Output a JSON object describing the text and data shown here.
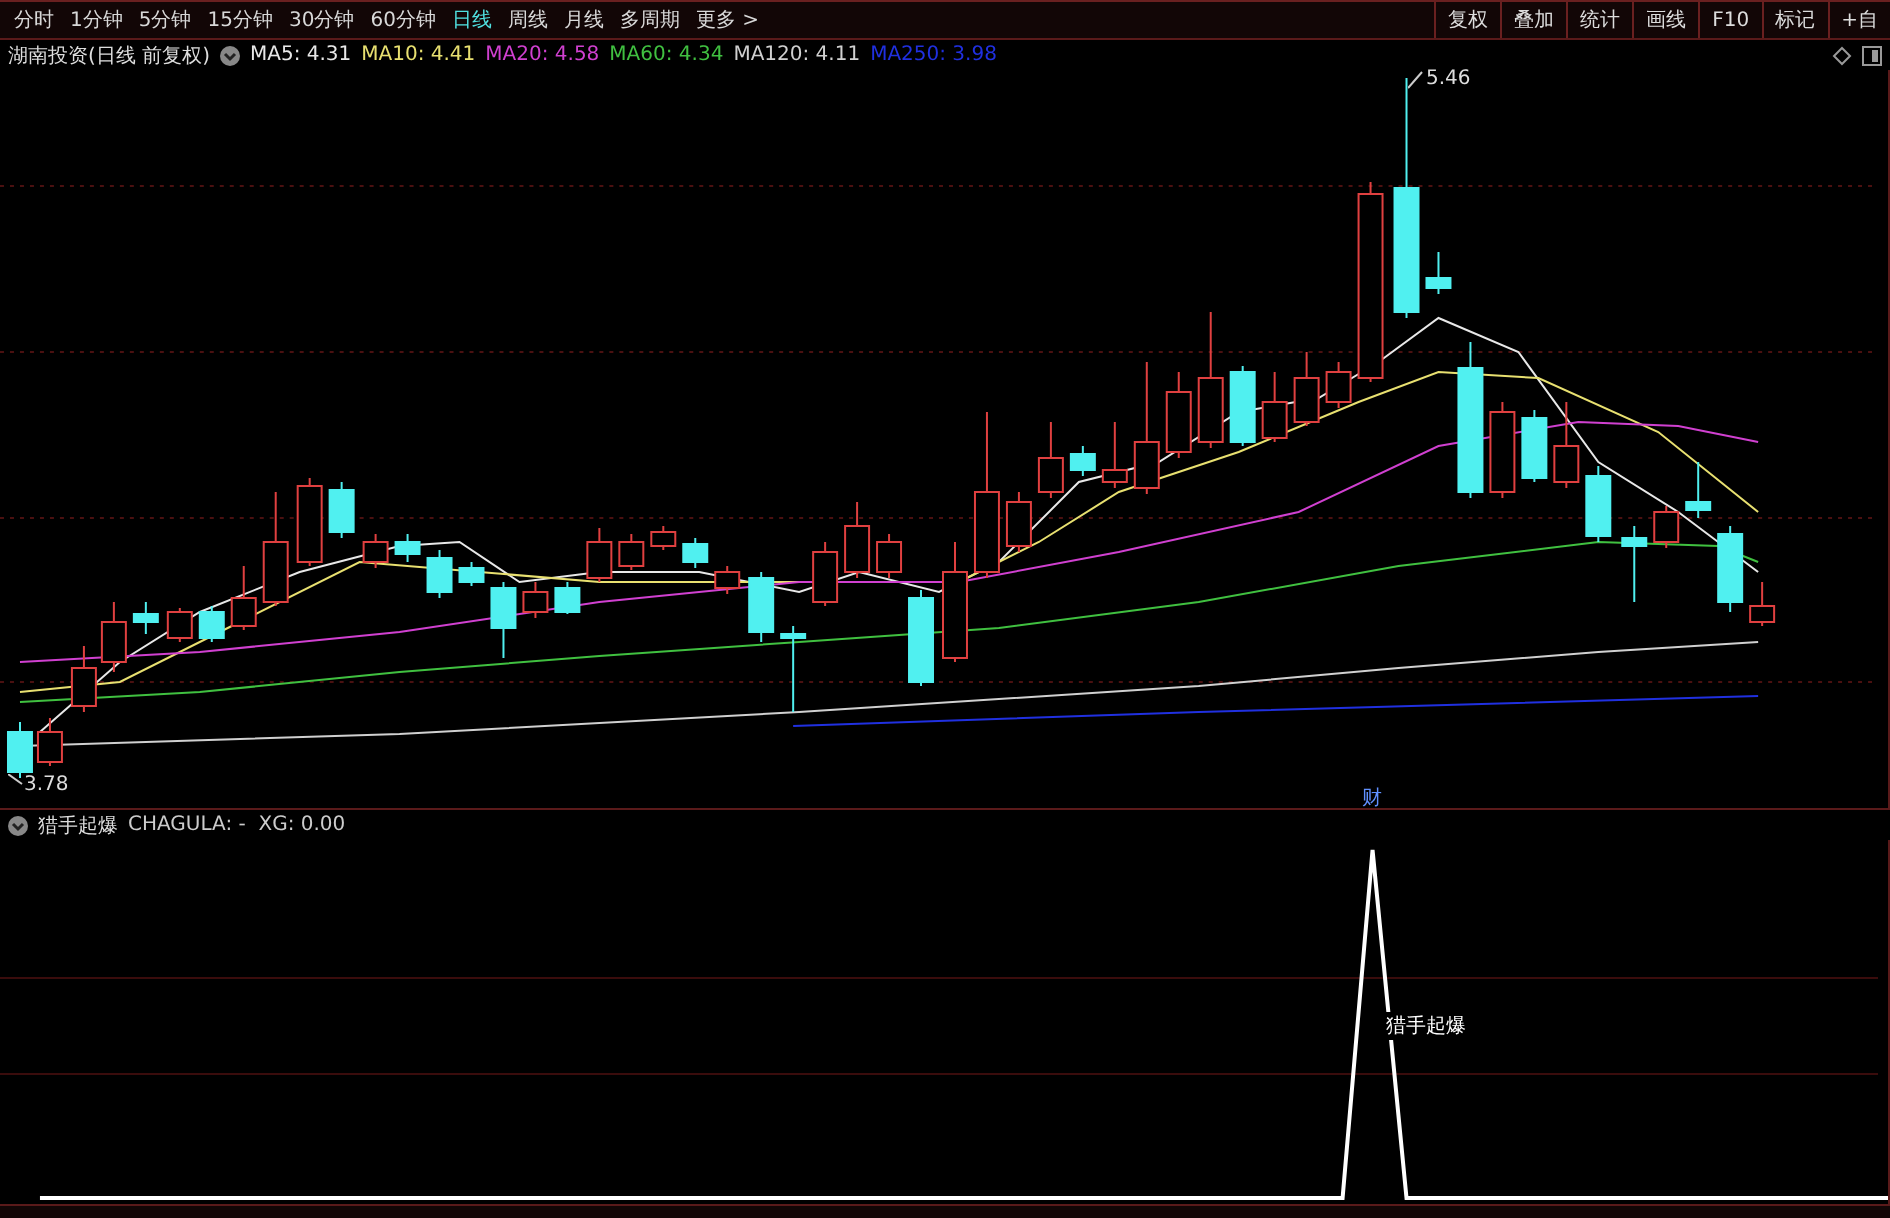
{
  "period_tabs": [
    {
      "label": "分时",
      "selected": false
    },
    {
      "label": "1分钟",
      "selected": false
    },
    {
      "label": "5分钟",
      "selected": false
    },
    {
      "label": "15分钟",
      "selected": false
    },
    {
      "label": "30分钟",
      "selected": false
    },
    {
      "label": "60分钟",
      "selected": false
    },
    {
      "label": "日线",
      "selected": true
    },
    {
      "label": "周线",
      "selected": false
    },
    {
      "label": "月线",
      "selected": false
    },
    {
      "label": "多周期",
      "selected": false
    },
    {
      "label": "更多 >",
      "selected": false
    }
  ],
  "tool_buttons": [
    "复权",
    "叠加",
    "统计",
    "画线",
    "F10",
    "标记",
    "+自"
  ],
  "main_chart": {
    "title": "湖南投资(日线 前复权)",
    "moving_averages": [
      {
        "label": "MA5: 4.31",
        "color": "#e8e8e8"
      },
      {
        "label": "MA10: 4.41",
        "color": "#e8e070"
      },
      {
        "label": "MA20: 4.58",
        "color": "#d040d0"
      },
      {
        "label": "MA60: 4.34",
        "color": "#40c040"
      },
      {
        "label": "MA120: 4.11",
        "color": "#d0d0d0"
      },
      {
        "label": "MA250: 3.98",
        "color": "#2030e0"
      }
    ],
    "high_label": "5.46",
    "low_label": "3.78"
  },
  "indicator": {
    "title": "猎手起爆",
    "values": "CHAGULA: -  XG: 0.00",
    "marker": "财",
    "signal_label": "猎手起爆"
  }
}
